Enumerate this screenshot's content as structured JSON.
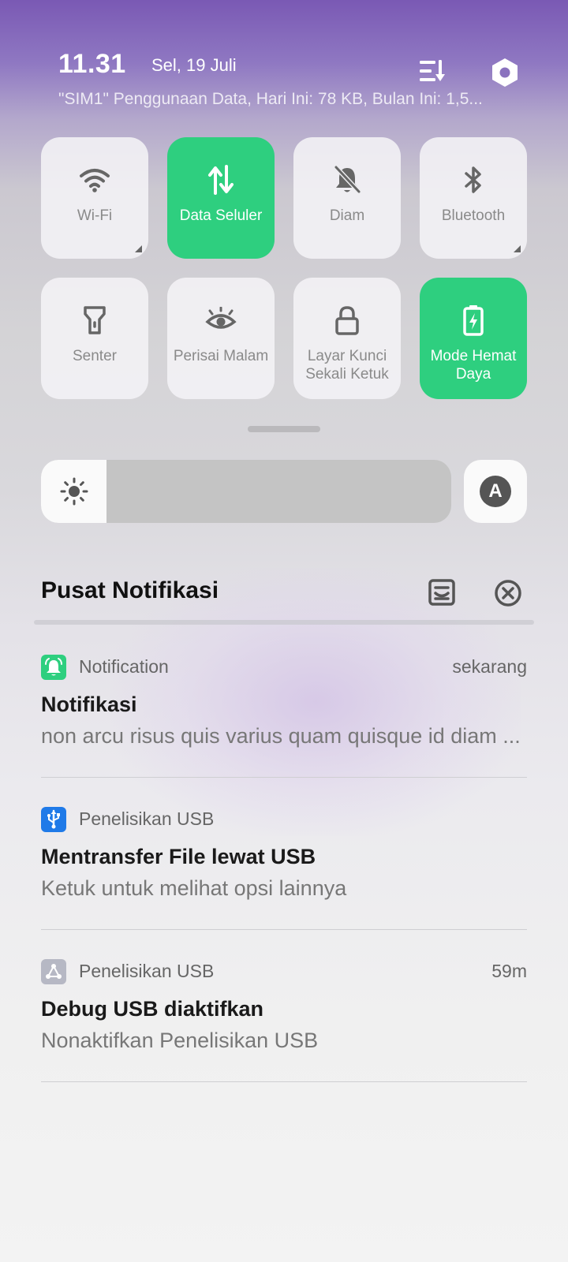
{
  "status": {
    "time": "11.31",
    "date": "Sel, 19 Juli",
    "data_usage": "\"SIM1\" Penggunaan Data, Hari Ini: 78 KB, Bulan Ini: 1,5..."
  },
  "header_icons": {
    "edit": "sort-list-icon",
    "settings": "hexagon-settings-icon"
  },
  "tiles": [
    {
      "label": "Wi-Fi",
      "icon": "wifi-icon",
      "active": false
    },
    {
      "label": "Data Seluler",
      "icon": "data-arrows-icon",
      "active": true
    },
    {
      "label": "Diam",
      "icon": "bell-off-icon",
      "active": false
    },
    {
      "label": "Bluetooth",
      "icon": "bluetooth-icon",
      "active": false
    },
    {
      "label": "Senter",
      "icon": "flashlight-icon",
      "active": false
    },
    {
      "label": "Perisai Malam",
      "icon": "eye-icon",
      "active": false
    },
    {
      "label": "Layar Kunci Sekali Ketuk",
      "icon": "lock-icon",
      "active": false
    },
    {
      "label": "Mode Hemat Daya",
      "icon": "battery-saver-icon",
      "active": true
    }
  ],
  "brightness": {
    "level": 0.16,
    "auto_label": "A"
  },
  "notification_center": {
    "title": "Pusat Notifikasi"
  },
  "notifications": [
    {
      "app": "Notification",
      "time": "sekarang",
      "title": "Notifikasi",
      "body": "non arcu risus quis varius quam quisque id diam ...",
      "icon": "bell-app-icon",
      "icon_color": "#2ecf7f"
    },
    {
      "app": "Penelisikan USB",
      "time": "",
      "title": "Mentransfer File lewat USB",
      "body": "Ketuk untuk melihat opsi lainnya",
      "icon": "usb-icon",
      "icon_color": "#1f7ae8"
    },
    {
      "app": "Penelisikan USB",
      "time": "59m",
      "title": "Debug USB diaktifkan",
      "body": "Nonaktifkan Penelisikan USB",
      "icon": "usb-debug-icon",
      "icon_color": "#b6b8c4"
    }
  ],
  "colors": {
    "accent_green": "#2ecf7f",
    "gradient_top": "#7a59b4"
  }
}
